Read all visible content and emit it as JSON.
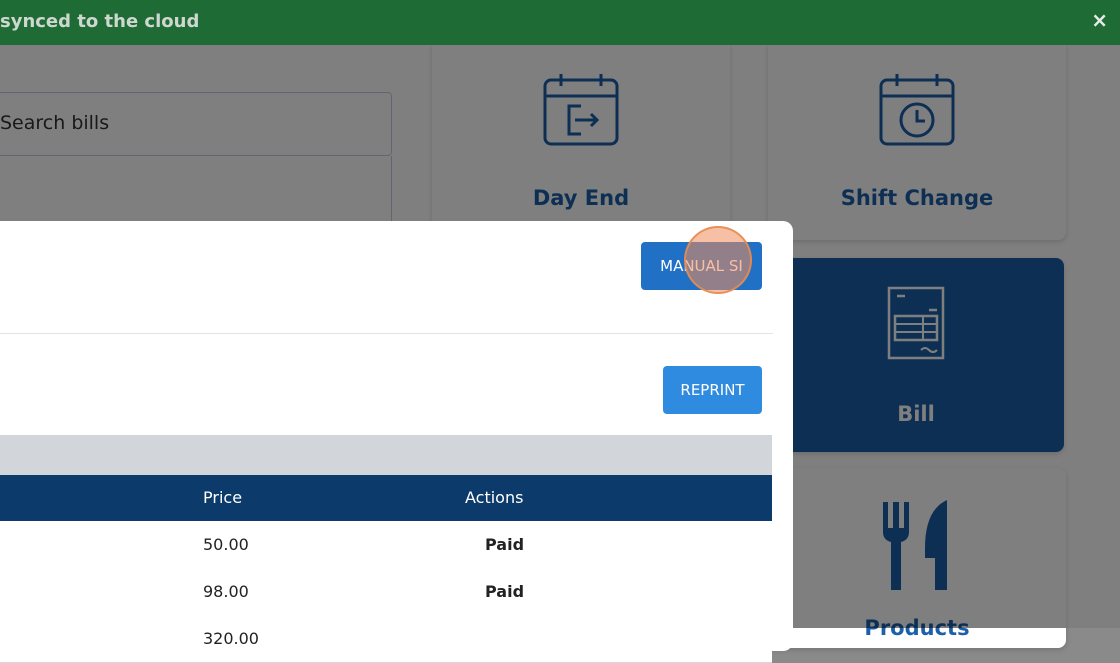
{
  "toast": {
    "message": "synced to the cloud",
    "close_icon": "×"
  },
  "search": {
    "placeholder": "Search bills"
  },
  "tiles": [
    {
      "label": "Day End",
      "icon": "calendar-exit-icon"
    },
    {
      "label": "Shift Change",
      "icon": "calendar-clock-icon"
    },
    {
      "label": "Bill",
      "icon": "receipt-icon"
    },
    {
      "label": "Products",
      "icon": "fork-knife-icon"
    }
  ],
  "modal": {
    "manual_button": "MANUAL SI",
    "reprint_button": "REPRINT",
    "table": {
      "headers": [
        "Price",
        "Actions"
      ],
      "rows": [
        {
          "price": "50.00",
          "action": "Paid"
        },
        {
          "price": "98.00",
          "action": "Paid"
        },
        {
          "price": "320.00",
          "action": ""
        }
      ]
    }
  },
  "colors": {
    "toast_bg": "#1f6b35",
    "primary": "#2070c6",
    "table_header": "#0c3a6b",
    "tile_active": "#1a5fa8"
  }
}
